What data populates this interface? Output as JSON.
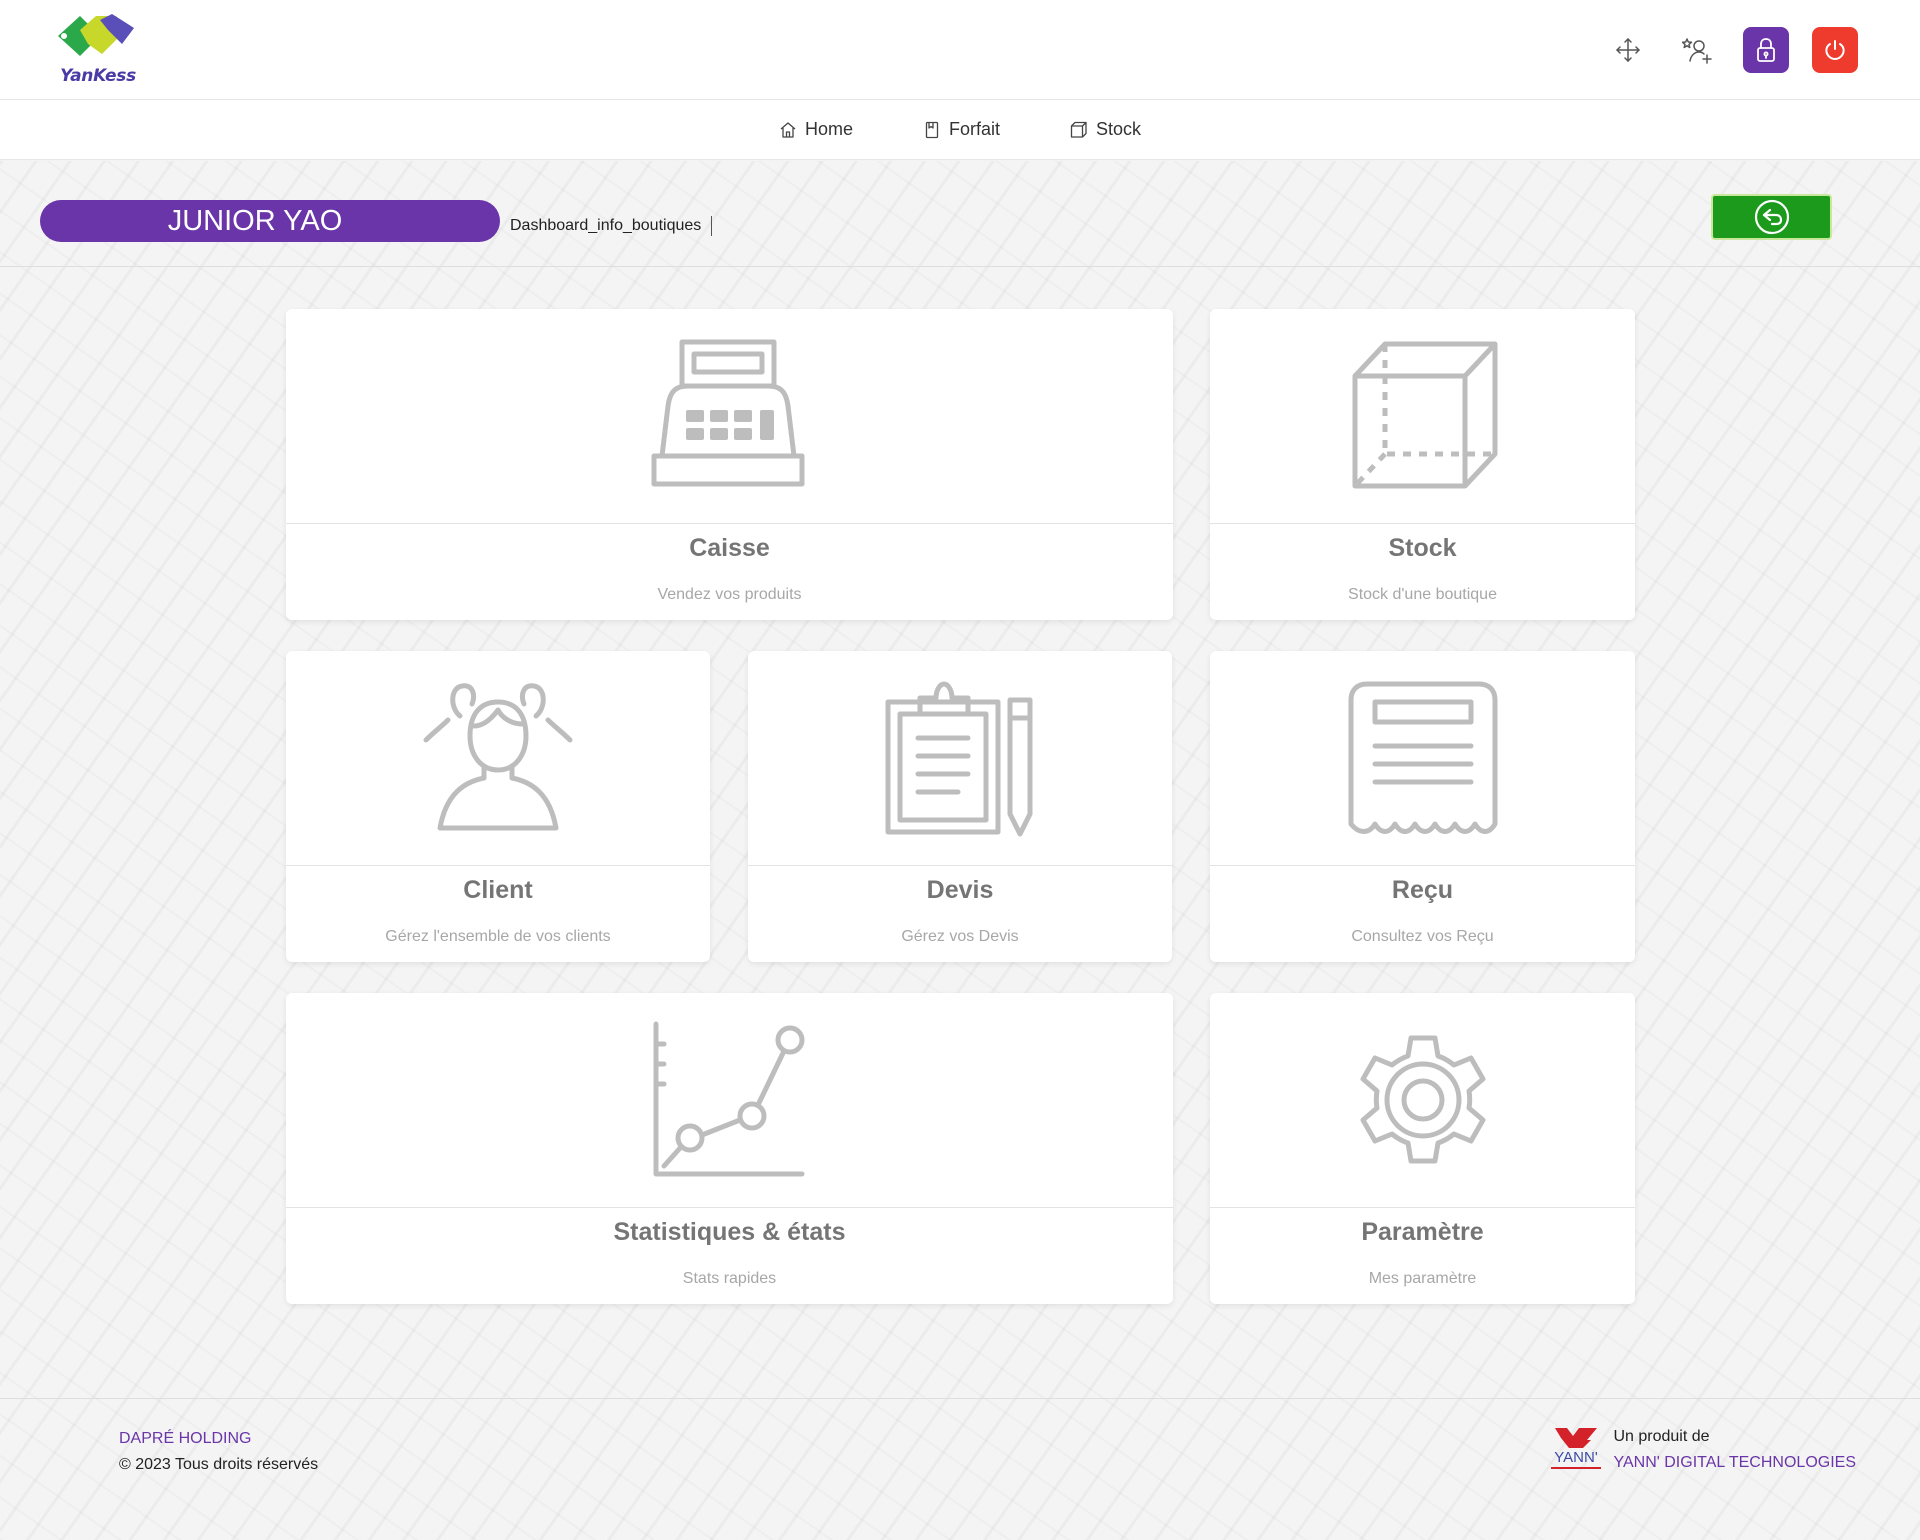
{
  "header": {
    "logo_text": "YanKess",
    "actions": [
      {
        "name": "fullscreen-icon"
      },
      {
        "name": "user-star-icon"
      },
      {
        "name": "lock-icon"
      },
      {
        "name": "power-icon"
      }
    ]
  },
  "nav": {
    "items": [
      {
        "label": "Home",
        "icon": "home-icon"
      },
      {
        "label": "Forfait",
        "icon": "bookmark-icon"
      },
      {
        "label": "Stock",
        "icon": "box-icon"
      }
    ]
  },
  "user": {
    "name": "JUNIOR YAO",
    "breadcrumb": "Dashboard_info_boutiques"
  },
  "cards": [
    {
      "title": "Caisse",
      "subtitle": "Vendez vos produits",
      "icon": "cash-register-icon"
    },
    {
      "title": "Stock",
      "subtitle": "Stock d'une boutique",
      "icon": "cube-icon"
    },
    {
      "title": "Client",
      "subtitle": "Gérez l'ensemble de vos clients",
      "icon": "users-icon"
    },
    {
      "title": "Devis",
      "subtitle": "Gérez vos Devis",
      "icon": "clipboard-pencil-icon"
    },
    {
      "title": "Reçu",
      "subtitle": "Consultez vos Reçu",
      "icon": "receipt-icon"
    },
    {
      "title": "Statistiques & états",
      "subtitle": "Stats rapides",
      "icon": "line-chart-icon"
    },
    {
      "title": "Paramètre",
      "subtitle": "Mes paramètre",
      "icon": "gear-icon"
    }
  ],
  "footer": {
    "holding": "DAPRÉ HOLDING",
    "copyright": "© 2023 Tous droits réservés",
    "produit_label": "Un produit de",
    "company": "YANN' DIGITAL TECHNOLOGIES",
    "partner_logo_text": "YANN'"
  },
  "colors": {
    "brand_purple": "#6a35a8",
    "danger_red": "#ef3b2d",
    "back_green": "#1b9a1b",
    "icon_gray": "#bdbdbd"
  }
}
